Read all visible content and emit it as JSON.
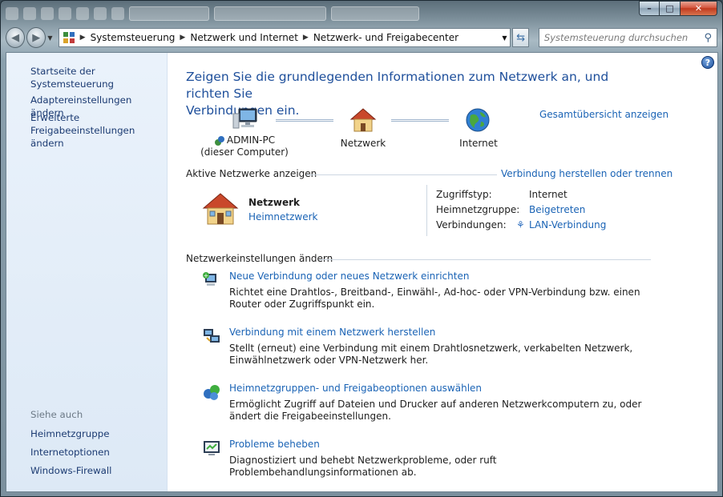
{
  "window": {
    "breadcrumb": [
      "Systemsteuerung",
      "Netzwerk und Internet",
      "Netzwerk- und Freigabecenter"
    ],
    "search_placeholder": "Systemsteuerung durchsuchen",
    "caption": {
      "minimize": "–",
      "maximize": "□",
      "close": "✕"
    }
  },
  "sidebar": {
    "home": "Startseite der Systemsteuerung",
    "adapter": "Adaptereinstellungen ändern",
    "advanced_line1": "Erweiterte",
    "advanced_line2": "Freigabeeinstellungen ändern",
    "see_also": "Siehe auch",
    "links": [
      "Heimnetzgruppe",
      "Internetoptionen",
      "Windows-Firewall"
    ]
  },
  "main": {
    "title_line1": "Zeigen Sie die grundlegenden Informationen zum Netzwerk an, und richten Sie",
    "title_line2": "Verbindungen ein.",
    "overview_link": "Gesamtübersicht anzeigen",
    "map": {
      "computer_line1": "ADMIN-PC",
      "computer_line2": "(dieser Computer)",
      "network": "Netzwerk",
      "internet": "Internet"
    },
    "active_networks": {
      "heading": "Aktive Netzwerke anzeigen",
      "connect_link": "Verbindung herstellen oder trennen",
      "network_name": "Netzwerk",
      "network_type": "Heimnetzwerk",
      "access_type_label": "Zugriffstyp:",
      "access_type_value": "Internet",
      "homegroup_label": "Heimnetzgruppe:",
      "homegroup_value": "Beigetreten",
      "connections_label": "Verbindungen:",
      "connections_value": "LAN-Verbindung"
    },
    "settings": {
      "heading": "Netzwerkeinstellungen ändern",
      "tasks": [
        {
          "link": "Neue Verbindung oder neues Netzwerk einrichten",
          "desc": "Richtet eine Drahtlos-, Breitband-, Einwähl-, Ad-hoc- oder VPN-Verbindung bzw. einen Router oder Zugriffspunkt ein.",
          "icon": "new-connection-icon"
        },
        {
          "link": "Verbindung mit einem Netzwerk herstellen",
          "desc": "Stellt (erneut) eine Verbindung mit einem Drahtlosnetzwerk, verkabelten Netzwerk, Einwählnetzwerk oder VPN-Netzwerk her.",
          "icon": "connect-network-icon"
        },
        {
          "link": "Heimnetzgruppen- und Freigabeoptionen auswählen",
          "desc": "Ermöglicht Zugriff auf Dateien und Drucker auf anderen Netzwerkcomputern zu, oder ändert die Freigabeeinstellungen.",
          "icon": "homegroup-icon"
        },
        {
          "link": "Probleme beheben",
          "desc": "Diagnostiziert und behebt Netzwerkprobleme, oder ruft Problembehandlungsinformationen ab.",
          "icon": "troubleshoot-icon"
        }
      ]
    }
  }
}
